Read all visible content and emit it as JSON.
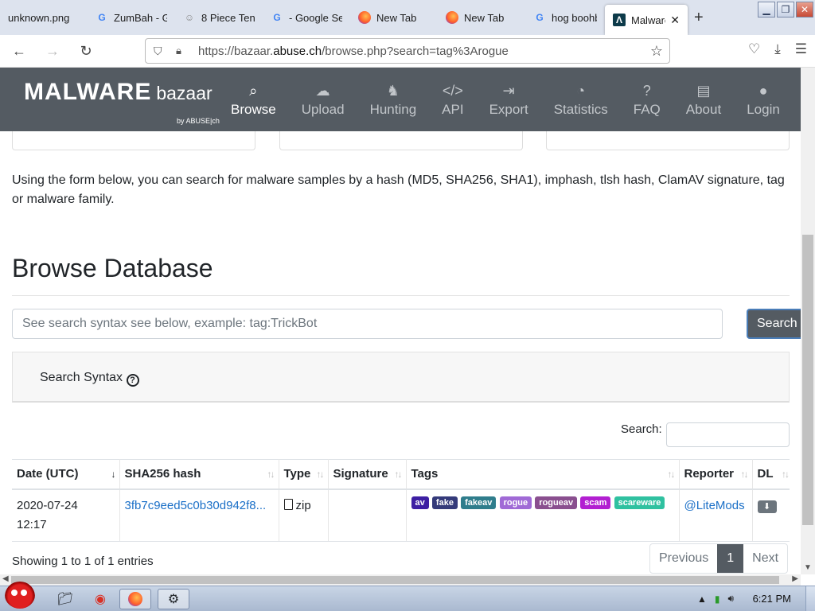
{
  "browser": {
    "tabs": [
      {
        "title": "unknown.png",
        "icon": "image-icon"
      },
      {
        "title": "ZumBah - G",
        "icon": "google-icon"
      },
      {
        "title": "8 Piece Ten",
        "icon": "site-icon"
      },
      {
        "title": "- Google Se",
        "icon": "google-icon"
      },
      {
        "title": "New Tab",
        "icon": "firefox-icon"
      },
      {
        "title": "New Tab",
        "icon": "firefox-icon"
      },
      {
        "title": "hog boohb",
        "icon": "google-icon"
      },
      {
        "title": "Malware",
        "icon": "malwarebazaar-icon",
        "active": true
      }
    ],
    "url_prefix": "https://bazaar.",
    "url_domain": "abuse.ch",
    "url_path": "/browse.php?search=tag%3Arogue"
  },
  "site": {
    "logo_main": "MALWARE",
    "logo_sub": "bazaar",
    "logo_by": "by ABUSE|ch",
    "menu": [
      {
        "label": "Browse",
        "icon": "search-icon",
        "active": true
      },
      {
        "label": "Upload",
        "icon": "cloud-upload-icon"
      },
      {
        "label": "Hunting",
        "icon": "hunting-icon"
      },
      {
        "label": "API",
        "icon": "code-icon"
      },
      {
        "label": "Export",
        "icon": "export-icon"
      },
      {
        "label": "Statistics",
        "icon": "pie-chart-icon"
      },
      {
        "label": "FAQ",
        "icon": "question-icon"
      },
      {
        "label": "About",
        "icon": "building-icon"
      },
      {
        "label": "Login",
        "icon": "user-icon"
      }
    ]
  },
  "main": {
    "intro": "Using the form below, you can search for malware samples by a hash (MD5, SHA256, SHA1), imphash, tlsh hash, ClamAV signature, tag or malware family.",
    "heading": "Browse Database",
    "search_placeholder": "See search syntax see below, example: tag:TrickBot",
    "search_button": "Search",
    "syntax_label": "Search Syntax",
    "table_search_label": "Search:",
    "columns": [
      "Date (UTC)",
      "SHA256 hash",
      "Type",
      "Signature",
      "Tags",
      "Reporter",
      "DL"
    ],
    "rows": [
      {
        "date": "2020-07-24",
        "time": "12:17",
        "hash": "3fb7c9eed5c0b30d942f8...",
        "type": "zip",
        "signature": "",
        "tags": [
          {
            "label": "av",
            "color": "#3d1fa3"
          },
          {
            "label": "fake",
            "color": "#343a7a"
          },
          {
            "label": "fakeav",
            "color": "#2f7d8c"
          },
          {
            "label": "rogue",
            "color": "#a06ad6"
          },
          {
            "label": "rogueav",
            "color": "#8a4f8f"
          },
          {
            "label": "scam",
            "color": "#b21fd1"
          },
          {
            "label": "scareware",
            "color": "#2fc1a0"
          }
        ],
        "reporter": "@LiteMods"
      }
    ],
    "showing": "Showing 1 to 1 of 1 entries",
    "pager": {
      "prev": "Previous",
      "current": "1",
      "next": "Next"
    }
  },
  "taskbar": {
    "clock": "6:21 PM"
  }
}
